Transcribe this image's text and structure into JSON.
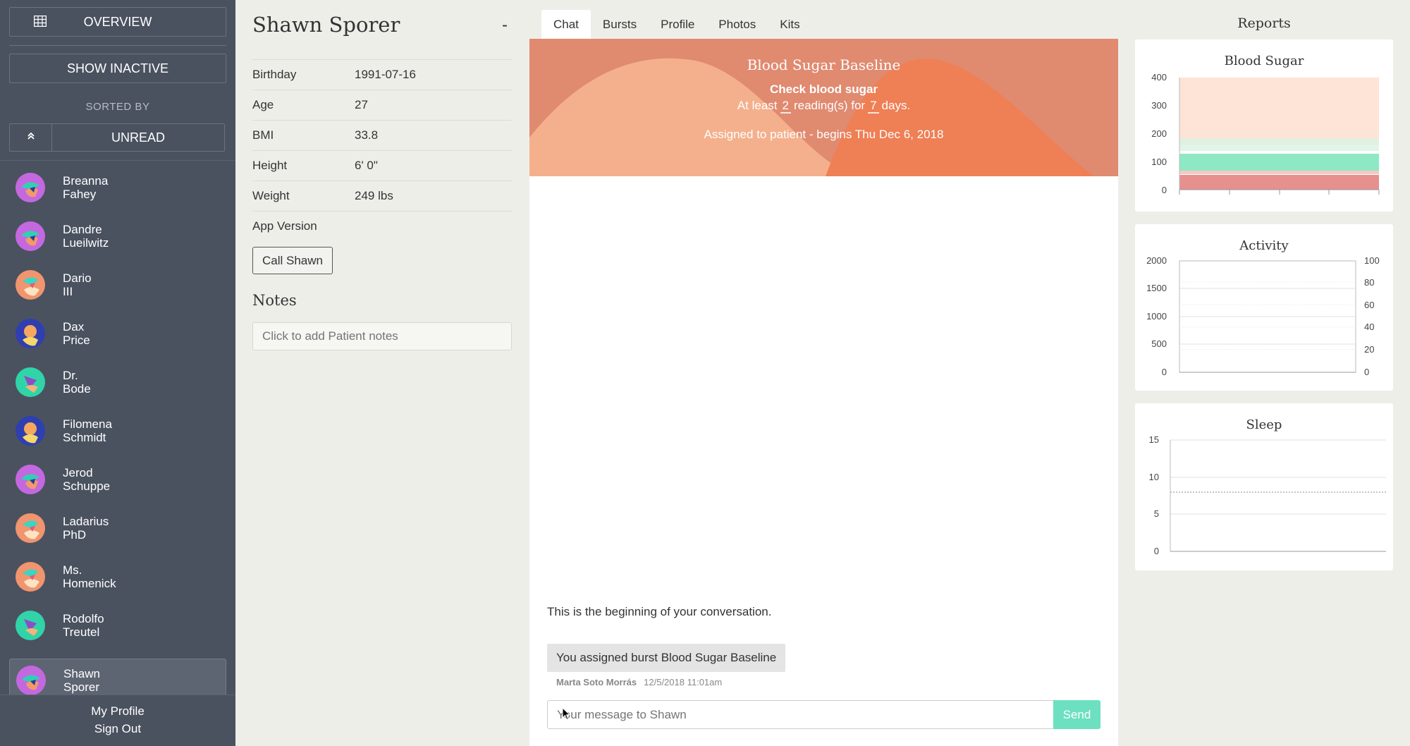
{
  "sidebar": {
    "overview_label": "OVERVIEW",
    "show_inactive_label": "SHOW INACTIVE",
    "sorted_by_label": "SORTED BY",
    "sort_field": "UNREAD",
    "patients": [
      {
        "first": "Breanna",
        "last": "Fahey"
      },
      {
        "first": "Dandre",
        "last": "Lueilwitz"
      },
      {
        "first": "Dario",
        "last": "III"
      },
      {
        "first": "Dax",
        "last": "Price"
      },
      {
        "first": "Dr.",
        "last": "Bode"
      },
      {
        "first": "Filomena",
        "last": "Schmidt"
      },
      {
        "first": "Jerod",
        "last": "Schuppe"
      },
      {
        "first": "Ladarius",
        "last": "PhD"
      },
      {
        "first": "Ms.",
        "last": "Homenick"
      },
      {
        "first": "Rodolfo",
        "last": "Treutel"
      },
      {
        "first": "Shawn",
        "last": "Sporer"
      }
    ],
    "footer": {
      "profile": "My Profile",
      "sign_out": "Sign Out"
    }
  },
  "patient": {
    "name": "Shawn Sporer",
    "collapse": "-",
    "fields": [
      {
        "label": "Birthday",
        "value": "1991-07-16"
      },
      {
        "label": "Age",
        "value": "27"
      },
      {
        "label": "BMI",
        "value": "33.8"
      },
      {
        "label": "Height",
        "value": "6' 0\""
      },
      {
        "label": "Weight",
        "value": "249 lbs"
      },
      {
        "label": "App Version",
        "value": ""
      }
    ],
    "call_button": "Call Shawn",
    "notes_title": "Notes",
    "notes_placeholder": "Click to add Patient notes"
  },
  "tabs": [
    "Chat",
    "Bursts",
    "Profile",
    "Photos",
    "Kits"
  ],
  "active_tab": "Chat",
  "burst": {
    "title": "Blood Sugar Baseline",
    "subtitle": "Check blood sugar",
    "line_prefix": "At least",
    "readings": "2",
    "line_mid": "reading(s) for",
    "days": "7",
    "line_suffix": "days.",
    "assigned": "Assigned to patient - begins Thu Dec 6, 2018"
  },
  "chat": {
    "beginning": "This is the beginning of your conversation.",
    "messages": [
      {
        "text": "You assigned burst Blood Sugar Baseline",
        "author": "Marta Soto Morrás",
        "time": "12/5/2018 11:01am"
      }
    ],
    "input_placeholder": "Your message to Shawn",
    "send_label": "Send"
  },
  "reports": {
    "title": "Reports",
    "blood_sugar": {
      "title": "Blood Sugar",
      "y_ticks": [
        "400",
        "300",
        "200",
        "100",
        "0"
      ]
    },
    "activity": {
      "title": "Activity",
      "left_ticks": [
        "2000",
        "1500",
        "1000",
        "500",
        "0"
      ],
      "right_ticks": [
        "100",
        "80",
        "60",
        "40",
        "20",
        "0"
      ]
    },
    "sleep": {
      "title": "Sleep",
      "y_ticks": [
        "15",
        "10",
        "5",
        "0"
      ]
    }
  },
  "colors": {
    "sidebar_bg": "#4a5260",
    "banner": "#e08a70",
    "send": "#6ce0c0",
    "sugar_high": "#fde4d6",
    "sugar_normal": "#8ee8c4",
    "sugar_low": "#e69090"
  }
}
